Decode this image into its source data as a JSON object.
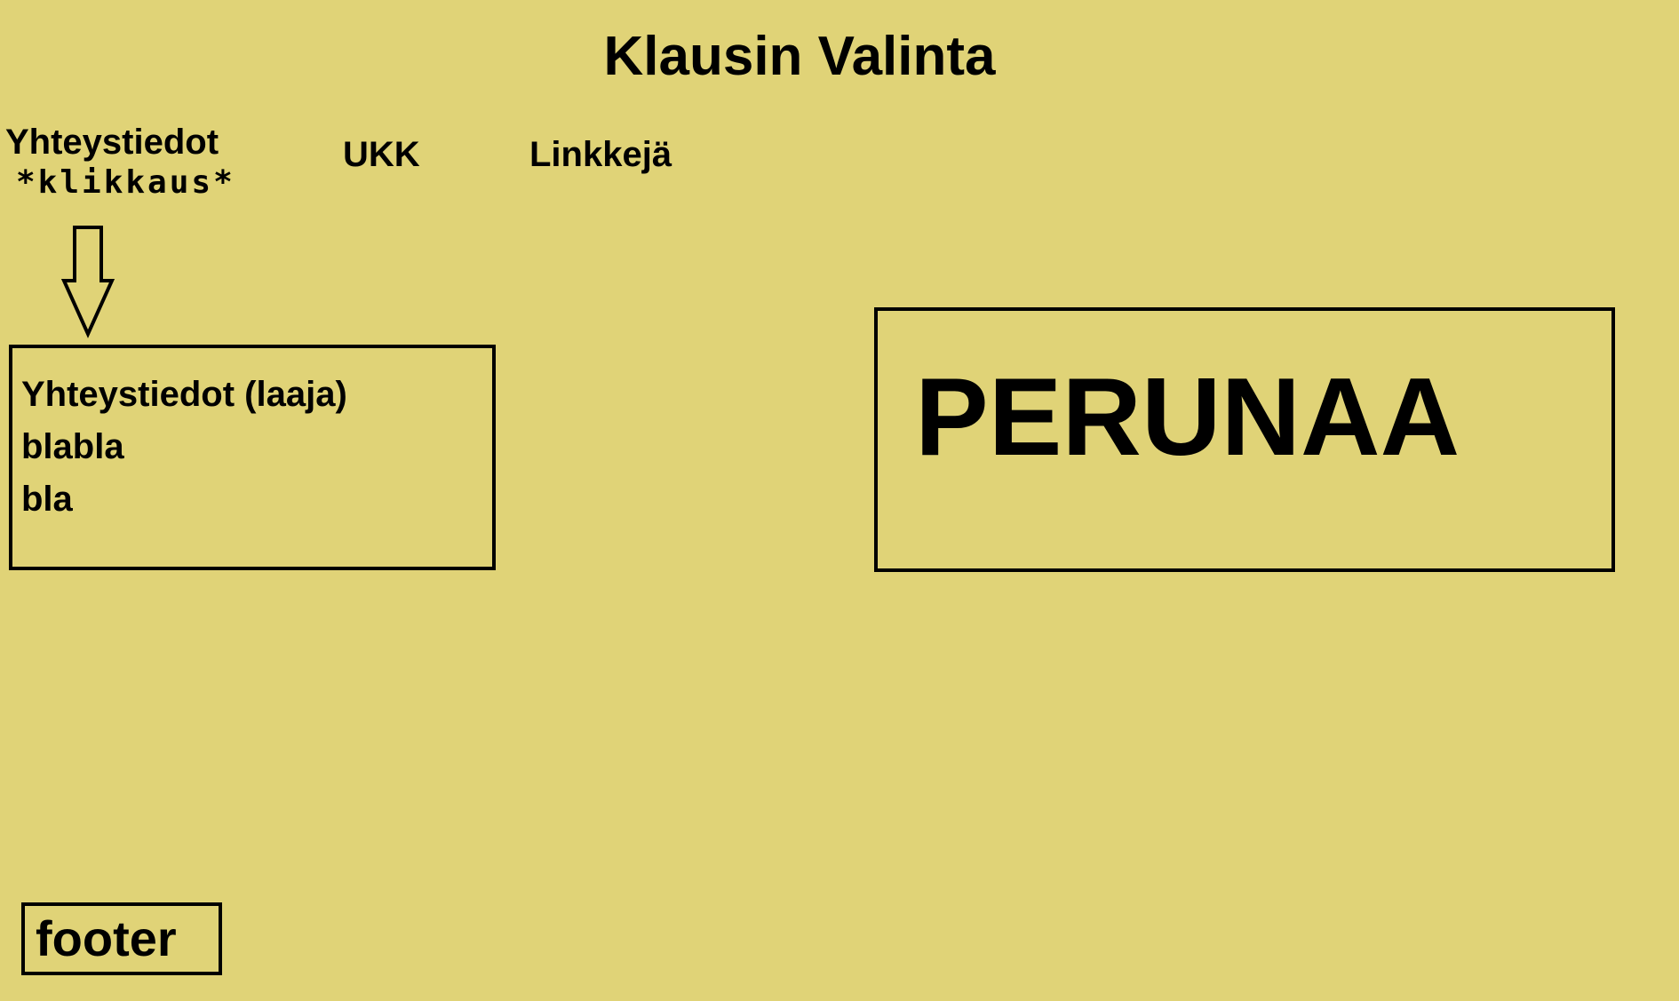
{
  "header": {
    "title": "Klausin Valinta"
  },
  "nav": {
    "items": [
      {
        "label": "Yhteystiedot"
      },
      {
        "label": "UKK"
      },
      {
        "label": "Linkkejä"
      }
    ],
    "click_note": "*klikkaus*"
  },
  "contact_panel": {
    "lines": [
      "Yhteystiedot (laaja)",
      "blabla",
      "bla"
    ]
  },
  "main_panel": {
    "text": "PERUNAA"
  },
  "footer": {
    "label": "footer"
  },
  "colors": {
    "background": "#e0d377",
    "ink": "#000000"
  },
  "icons": {
    "arrow": "arrow-down-outline-icon"
  }
}
